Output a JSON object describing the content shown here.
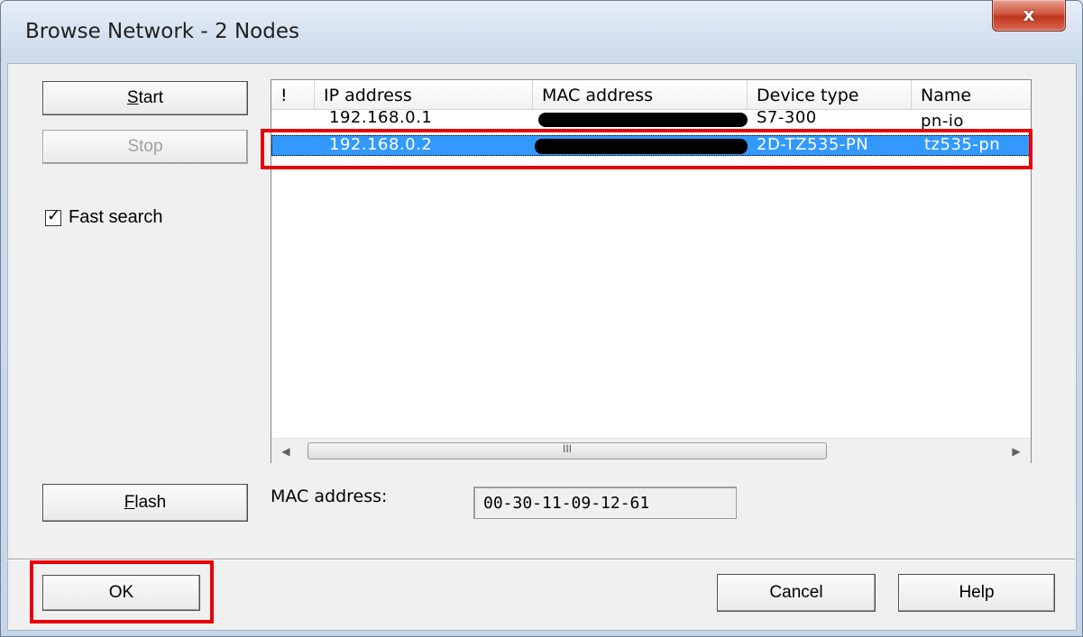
{
  "window": {
    "title": "Browse Network - 2 Nodes",
    "close_glyph": "x"
  },
  "buttons": {
    "start": "Start",
    "stop": "Stop",
    "flash": "Flash",
    "ok": "OK",
    "cancel": "Cancel",
    "help": "Help"
  },
  "fast_search": {
    "label": "Fast search",
    "checked": true
  },
  "table": {
    "columns": [
      "!",
      "IP address",
      "MAC address",
      "Device type",
      "Name"
    ],
    "rows": [
      {
        "ip": "192.168.0.1",
        "mac": "",
        "device_type": "S7-300",
        "name": "pn-io",
        "selected": false
      },
      {
        "ip": "192.168.0.2",
        "mac": "",
        "device_type": "2D-TZ535-PN",
        "name": "tz535-pn",
        "selected": true
      }
    ],
    "scroll_thumb_glyph": "III"
  },
  "mac_address": {
    "label": "MAC address:",
    "value": "00-30-11-09-12-61"
  },
  "colors": {
    "selection": "#3399ff",
    "highlight": "#e8000b"
  }
}
